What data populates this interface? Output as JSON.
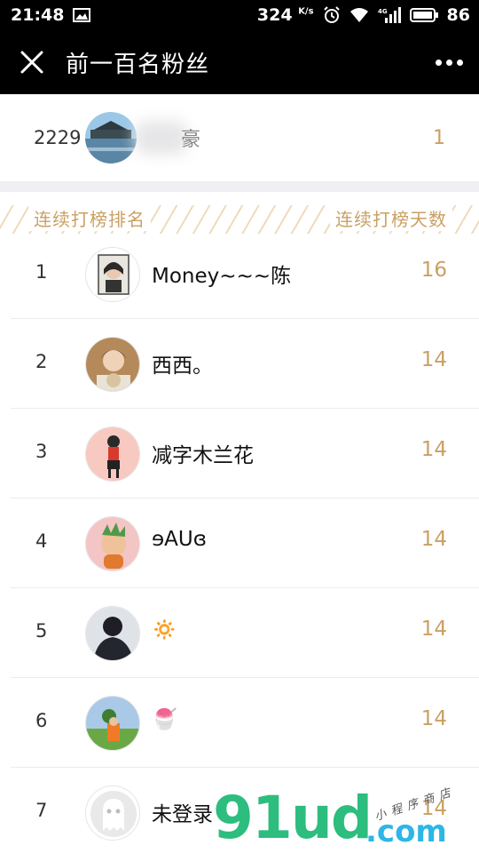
{
  "status_bar": {
    "time": "21:48",
    "speed": "324",
    "speed_unit": "K/s",
    "network": "4G",
    "battery": "86",
    "icons": [
      "image-icon",
      "alarm-icon",
      "wifi-icon",
      "signal-icon",
      "battery-icon"
    ]
  },
  "nav": {
    "title": "前一百名粉丝",
    "close_icon": "close-icon",
    "more_icon": "more-icon"
  },
  "my_entry": {
    "rank": "2229",
    "name": "豪",
    "count": "1"
  },
  "list_header": {
    "left": "连续打榜排名",
    "right": "连续打榜天数"
  },
  "fans": [
    {
      "rank": "1",
      "name": "Money~~~陈",
      "count": "16"
    },
    {
      "rank": "2",
      "name": "西西。",
      "count": "14"
    },
    {
      "rank": "3",
      "name": "减字木兰花",
      "count": "14"
    },
    {
      "rank": "4",
      "name": "ɘAUɞ",
      "count": "14"
    },
    {
      "rank": "5",
      "name": "🔅",
      "count": "14"
    },
    {
      "rank": "6",
      "name": "🍧",
      "count": "14"
    },
    {
      "rank": "7",
      "name": "未登录",
      "count": "14"
    }
  ],
  "watermark": {
    "brand": "91ud",
    "domain": ".com",
    "tagline": "小程序商店"
  },
  "colors": {
    "accent": "#c9a063",
    "bar": "#000000",
    "background": "#efeff4"
  }
}
